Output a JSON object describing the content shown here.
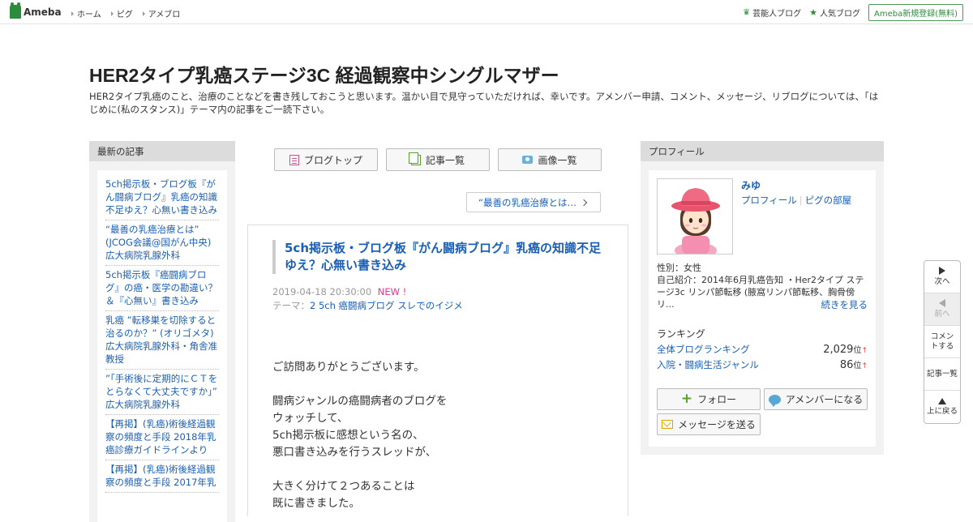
{
  "header": {
    "logo_text": "Ameba",
    "nav": [
      {
        "label": "ホーム"
      },
      {
        "label": "ピグ"
      },
      {
        "label": "アメブロ"
      }
    ],
    "right_links": [
      {
        "label": "芸能人ブログ",
        "icon": "crown-icon"
      },
      {
        "label": "人気ブログ",
        "icon": "star-icon"
      }
    ],
    "register_label": "Ameba新規登録(無料)"
  },
  "blog": {
    "title": "HER2タイプ乳癌ステージ3C 経過観察中シングルマザー",
    "description": "HER2タイプ乳癌のこと、治療のことなどを書き残しておこうと思います。温かい目で見守っていただければ、幸いです。アメンバー申請、コメント、メッセージ、リブログについては、「はじめに(私のスタンス)」テーマ内の記事をご一読下さい。"
  },
  "recent": {
    "heading": "最新の記事",
    "items": [
      {
        "label": "5ch掲示板・ブログ板『がん闘病ブログ』乳癌の知識不足ゆえ？心無い書き込み"
      },
      {
        "label": "“最善の乳癌治療とは” (JCOG会議@国がん中央)広大病院乳腺外科"
      },
      {
        "label": "5ch掲示板『癌闘病ブログ』の癌・医学の勘違い？＆『心無い』書き込み"
      },
      {
        "label": "乳癌 ”転移巣を切除すると治るのか？” (オリゴメタ) 広大病院乳腺外科・角舎准教授"
      },
      {
        "label": "”「手術後に定期的にＣＴをとらなくて大丈夫ですか」” 広大病院乳腺外科"
      },
      {
        "label": "【再掲】(乳癌)術後経過観察の頻度と手段 2018年乳癌診療ガイドラインより"
      },
      {
        "label": "【再掲】(乳癌)術後経過観察の頻度と手段 2017年乳"
      }
    ]
  },
  "toolbar": {
    "buttons": [
      {
        "label": "ブログトップ"
      },
      {
        "label": "記事一覧"
      },
      {
        "label": "画像一覧"
      }
    ],
    "prev_article": "“最善の乳癌治療とは…"
  },
  "article": {
    "title": "5ch掲示板・ブログ板『がん闘病ブログ』乳癌の知識不足ゆえ？心無い書き込み",
    "datetime": "2019-04-18 20:30:00",
    "new_badge": "NEW !",
    "theme_prefix": "テーマ：",
    "theme": "2 5ch 癌闘病ブログ スレでのイジメ",
    "paragraphs": [
      "ご訪問ありがとうございます。",
      "",
      "闘病ジャンルの癌闘病者のブログを",
      "ウォッチして、",
      "5ch掲示板に感想という名の、",
      "悪口書き込みを行うスレッドが、",
      "",
      "大きく分けて２つあることは",
      "既に書きました。"
    ]
  },
  "profile": {
    "heading": "プロフィール",
    "name": "みゆ",
    "link_profile": "プロフィール",
    "link_separator": "|",
    "link_room": "ピグの部屋",
    "gender": "性別：女性",
    "intro": "自己紹介：2014年6月乳癌告知 ・Her2タイプ ステージ3c リンパ節転移 (腋窩リンパ節転移、胸骨傍リ...",
    "more": "続きを見る",
    "ranking_heading": "ランキング",
    "rankings": [
      {
        "label": "全体ブログランキング",
        "value": "2,029",
        "unit": "位",
        "trend": "↑"
      },
      {
        "label": "入院・闘病生活ジャンル",
        "value": "86",
        "unit": "位",
        "trend": "↑"
      }
    ],
    "follow_label": "フォロー",
    "amember_label": "アメンバーになる",
    "message_label": "メッセージを送る"
  },
  "side_nav": {
    "next": "次へ",
    "prev": "前へ",
    "comment": "コメントする",
    "list": "記事一覧",
    "top": "上に戻る"
  },
  "colors": {
    "link": "#1a5fb4",
    "brand_green": "#2d8c3c",
    "new_badge": "#e8378a"
  }
}
